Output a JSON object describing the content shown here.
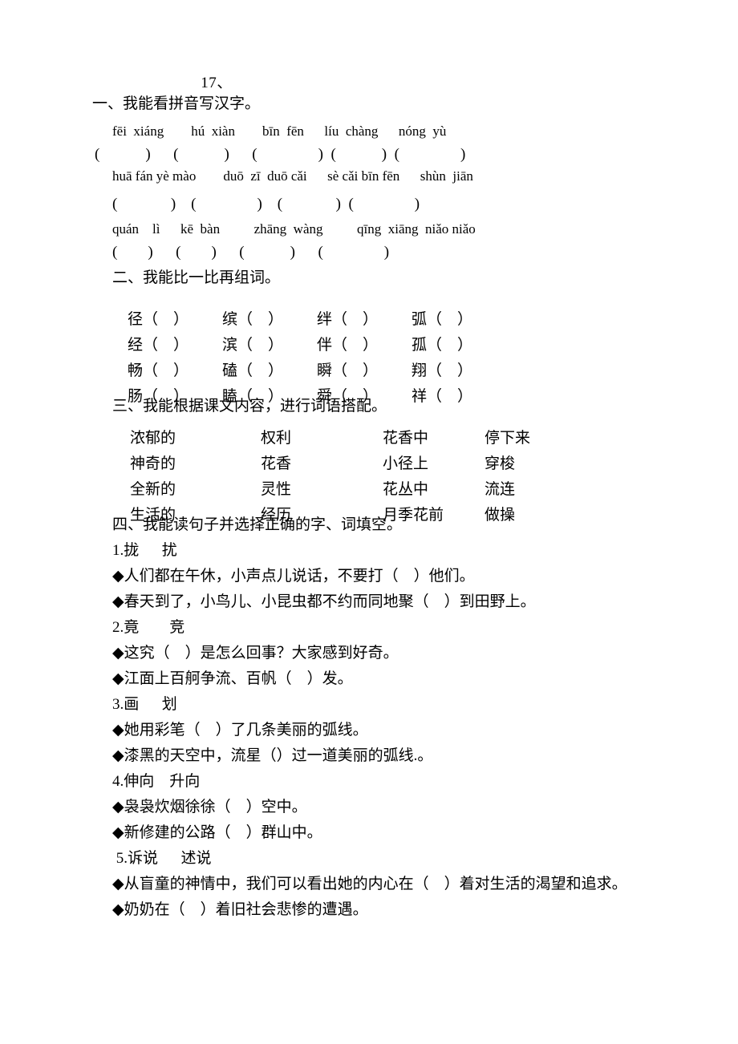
{
  "document": {
    "title": "17、"
  },
  "section1": {
    "heading": "一、我能看拼音写汉字。",
    "pinyin_rows": [
      "fēi  xiáng        hú  xiàn        bīn  fēn      líu  chàng      nóng  yù",
      "huā fán yè mào        duō  zī  duō cǎi      sè cǎi bīn fēn      shùn  jiān",
      "quán    lì      kē  bàn          zhāng  wàng          qīng  xiāng  niǎo niǎo"
    ],
    "bracket_rows": [
      "(            )      (            )      (                )  (            )  (                )",
      "(              )    (                )    (              )  (                )",
      "(        )      (        )      (            )      (                )"
    ]
  },
  "section2": {
    "heading": "二、我能比一比再组词。",
    "rows": [
      [
        "径（    ）",
        "缤（    ）",
        "绊（    ）",
        "弧（    ）"
      ],
      [
        "经（    ）",
        "滨（    ）",
        "伴（    ）",
        "孤（    ）"
      ],
      [
        "畅（    ）",
        "磕（    ）",
        "瞬（    ）",
        "翔（    ）"
      ],
      [
        "肠（    ）",
        "瞌（    ）",
        "舜（    ）",
        "祥（    ）"
      ]
    ]
  },
  "section3": {
    "heading": "三、我能根据课文内容，进行词语搭配。",
    "rows": [
      [
        "浓郁的",
        "权利",
        "花香中",
        "停下来"
      ],
      [
        "神奇的",
        "花香",
        "小径上",
        "穿梭"
      ],
      [
        "全新的",
        "灵性",
        "花丛中",
        "流连"
      ],
      [
        "生活的",
        "经历",
        "月季花前",
        "做操"
      ]
    ]
  },
  "section4": {
    "heading": "四、我能读句子并选择正确的字、词填空。",
    "items": [
      {
        "choice": "1.拢      扰",
        "sentences": [
          "◆人们都在午休，小声点儿说话，不要打（    ）他们。",
          "◆春天到了，小鸟儿、小昆虫都不约而同地聚（    ）到田野上。"
        ]
      },
      {
        "choice": "2.竟        竞",
        "sentences": [
          "◆这究（    ）是怎么回事？大家感到好奇。",
          "◆江面上百舸争流、百帆（    ）发。"
        ]
      },
      {
        "choice": "3.画      划",
        "sentences": [
          "◆她用彩笔（    ）了几条美丽的弧线。",
          "◆漆黑的天空中，流星（）过一道美丽的弧线.。"
        ]
      },
      {
        "choice": "4.伸向    升向",
        "sentences": [
          "◆袅袅炊烟徐徐（    ）空中。",
          "◆新修建的公路（    ）群山中。"
        ]
      },
      {
        "choice": " 5.诉说      述说",
        "sentences": [
          "◆从盲童的神情中，我们可以看出她的内心在（    ）着对生活的渴望和追求。",
          "◆奶奶在（    ）着旧社会悲惨的遭遇。"
        ]
      }
    ]
  }
}
